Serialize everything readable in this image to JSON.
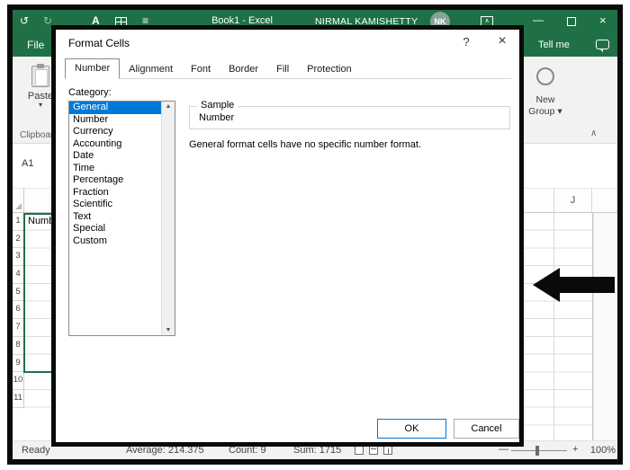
{
  "colors": {
    "excel_green": "#1f7145",
    "selection_blue": "#0078d7",
    "annotation_black": "#0a0a0a"
  },
  "glyphs": {
    "undo": "↺",
    "redo": "↻",
    "font_button": "A",
    "menu": "≡",
    "minimize": "—",
    "close": "×",
    "dropdown": "▾",
    "collapse": "∧",
    "scroll_up": "▲",
    "scroll_down": "▼",
    "zoom_out": "—",
    "zoom_in": "+",
    "help": "?",
    "dialog_close": "×"
  },
  "title_bar": {
    "workbook_title": "Book1 - Excel",
    "user_name": "NIRMAL KAMISHETTY",
    "avatar_initials": "NK"
  },
  "menu_row": {
    "file": "File",
    "tell_me": "Tell me"
  },
  "ribbon": {
    "paste_label": "Paste",
    "clipboard_group_label": "Clipboard",
    "new_group_line1": "New",
    "new_group_line2": "Group"
  },
  "formula_bar": {
    "name_box": "A1"
  },
  "sheet": {
    "column_j": "J",
    "cell_a1": "Number",
    "row_numbers": [
      "1",
      "2",
      "3",
      "4",
      "5",
      "6",
      "7",
      "8",
      "9",
      "10",
      "11"
    ]
  },
  "status_bar": {
    "mode": "Ready",
    "average": "Average: 214.375",
    "count": "Count: 9",
    "sum": "Sum: 1715",
    "zoom_level": "100%"
  },
  "dialog": {
    "title": "Format Cells",
    "tabs": [
      "Number",
      "Alignment",
      "Font",
      "Border",
      "Fill",
      "Protection"
    ],
    "active_tab": "Number",
    "category_label": "Category:",
    "categories": [
      "General",
      "Number",
      "Currency",
      "Accounting",
      "Date",
      "Time",
      "Percentage",
      "Fraction",
      "Scientific",
      "Text",
      "Special",
      "Custom"
    ],
    "selected_category": "General",
    "sample_group_label": "Sample",
    "sample_value": "Number",
    "description": "General format cells have no specific number format.",
    "ok_label": "OK",
    "cancel_label": "Cancel"
  }
}
